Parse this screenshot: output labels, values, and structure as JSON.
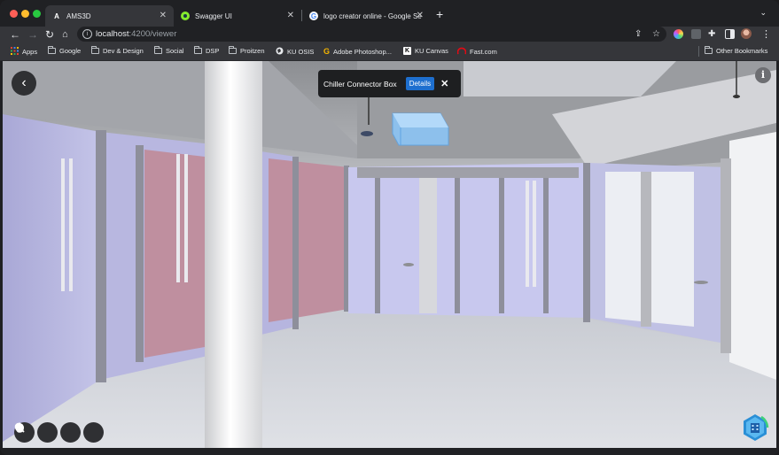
{
  "tabs": [
    {
      "title": "AMS3D",
      "favicon": "A",
      "active": true
    },
    {
      "title": "Swagger UI",
      "favicon": "swagger-icon",
      "active": false
    },
    {
      "title": "logo creator online - Google Se",
      "favicon": "google-icon",
      "active": false
    }
  ],
  "toolbar": {
    "url_host": "localhost",
    "url_path": ":4200/viewer"
  },
  "bookmarks": [
    {
      "label": "Apps",
      "icon": "apps-grid-icon"
    },
    {
      "label": "Google",
      "icon": "folder-icon"
    },
    {
      "label": "Dev & Design",
      "icon": "folder-icon"
    },
    {
      "label": "Social",
      "icon": "folder-icon"
    },
    {
      "label": "DSP",
      "icon": "folder-icon"
    },
    {
      "label": "Proitzen",
      "icon": "folder-icon"
    },
    {
      "label": "KU OSIS",
      "icon": "globe-icon"
    },
    {
      "label": "Adobe Photoshop...",
      "icon": "g-icon"
    },
    {
      "label": "KU Canvas",
      "icon": "k-icon"
    },
    {
      "label": "Fast.com",
      "icon": "fast-icon"
    }
  ],
  "other_bookmarks": "Other Bookmarks",
  "viewer": {
    "popup_title": "Chiller Connector Box",
    "popup_details": "Details",
    "info_label": "i",
    "tools": [
      "compass-icon",
      "hand-pan-icon",
      "zoom-icon",
      "person-walk-icon"
    ]
  },
  "colors": {
    "accent": "#1e6fcf",
    "selection": "#8cc4f5",
    "logo": "#2a8fd6"
  }
}
